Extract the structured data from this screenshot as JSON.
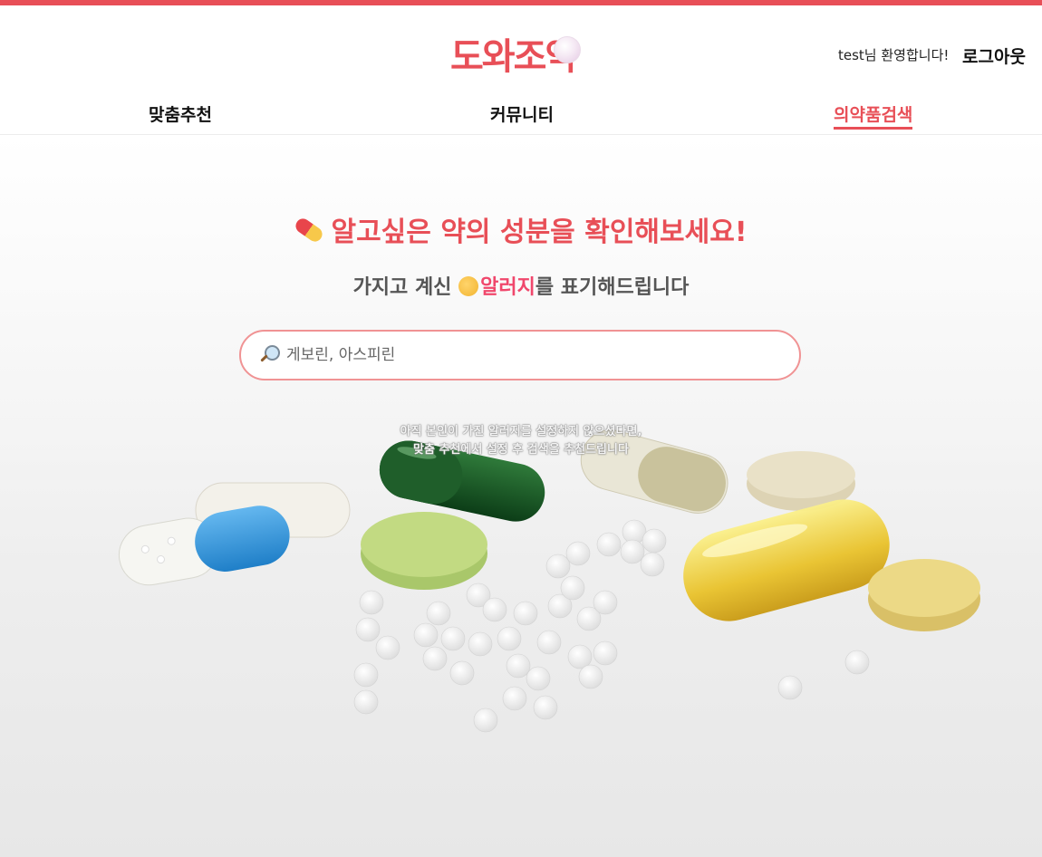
{
  "header": {
    "logo_text": "도와조약",
    "welcome_text": "test님 환영합니다!",
    "logout_label": "로그아웃",
    "accent_color": "#e84f57"
  },
  "nav": {
    "items": [
      {
        "label": "맞춤추천",
        "active": false
      },
      {
        "label": "커뮤니티",
        "active": false
      },
      {
        "label": "의약품검색",
        "active": true
      }
    ]
  },
  "hero": {
    "headline": "알고싶은 약의 성분을 확인해보세요!",
    "headline_icon": "pill-icon",
    "subline_prefix": "가지고 계신 ",
    "subline_icon": "sneezing-face-icon",
    "subline_highlight": "알러지",
    "subline_suffix": "를 표기해드립니다",
    "search": {
      "icon": "magnifier-icon",
      "placeholder": "게보린, 아스피린",
      "value": ""
    },
    "note_line1": "아직 본인이 가진 알러지를 설정하지 않으셨다면,",
    "note_line2": "맞춤 추천에서 설정 후 검색을 추천드립니다"
  }
}
